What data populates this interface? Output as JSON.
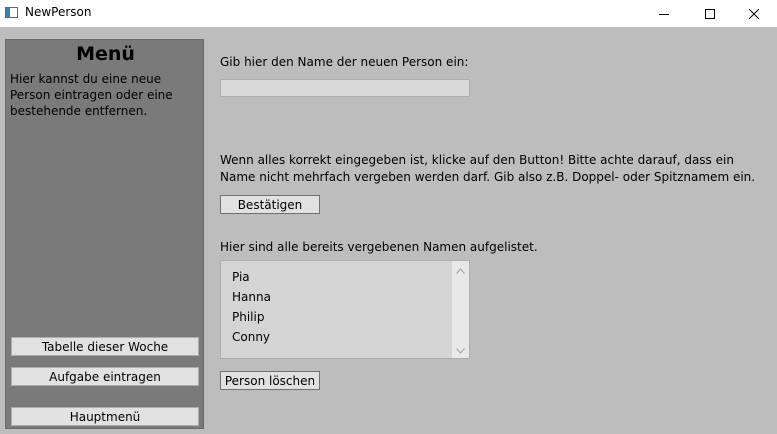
{
  "window": {
    "title": "NewPerson",
    "controls": [
      "minimize-icon",
      "maximize-icon",
      "close-icon"
    ]
  },
  "sidebar": {
    "title": "Menü",
    "description": "Hier kannst du eine neue Person eintragen oder eine bestehende entfernen.",
    "buttons": {
      "week_table": "Tabelle dieser Woche",
      "add_task": "Aufgabe eintragen",
      "main_menu": "Hauptmenü"
    }
  },
  "main": {
    "name_prompt": "Gib hier den Name der neuen Person ein:",
    "name_input": {
      "value": "",
      "placeholder": ""
    },
    "info_text": "Wenn alles korrekt eingegeben ist, klicke auf den Button! Bitte achte darauf, dass ein Name nicht mehrfach vergeben werden darf. Gib also z.B. Doppel- oder Spitznamem ein.",
    "confirm_button": "Bestätigen",
    "list_caption": "Hier sind alle bereits vergebenen Namen aufgelistet.",
    "names": [
      "Pia",
      "Hanna",
      "Philip",
      "Conny"
    ],
    "delete_button": "Person löschen"
  },
  "colors": {
    "background": "#bdbdbd",
    "sidebar": "#7a7a7a",
    "button": "#e1e1e1"
  }
}
